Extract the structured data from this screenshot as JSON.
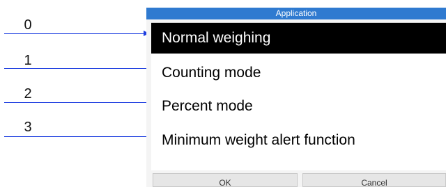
{
  "callouts": [
    "0",
    "1",
    "2",
    "3"
  ],
  "dialog": {
    "title": "Application",
    "items": [
      {
        "label": "Normal weighing",
        "selected": true
      },
      {
        "label": "Counting mode",
        "selected": false
      },
      {
        "label": "Percent mode",
        "selected": false
      },
      {
        "label": "Minimum weight alert function",
        "selected": false
      }
    ],
    "ok_label": "OK",
    "cancel_label": "Cancel"
  },
  "colors": {
    "titlebar": "#2f7ad0",
    "callout_line": "#1f3fe0",
    "selected_bg": "#000000"
  }
}
